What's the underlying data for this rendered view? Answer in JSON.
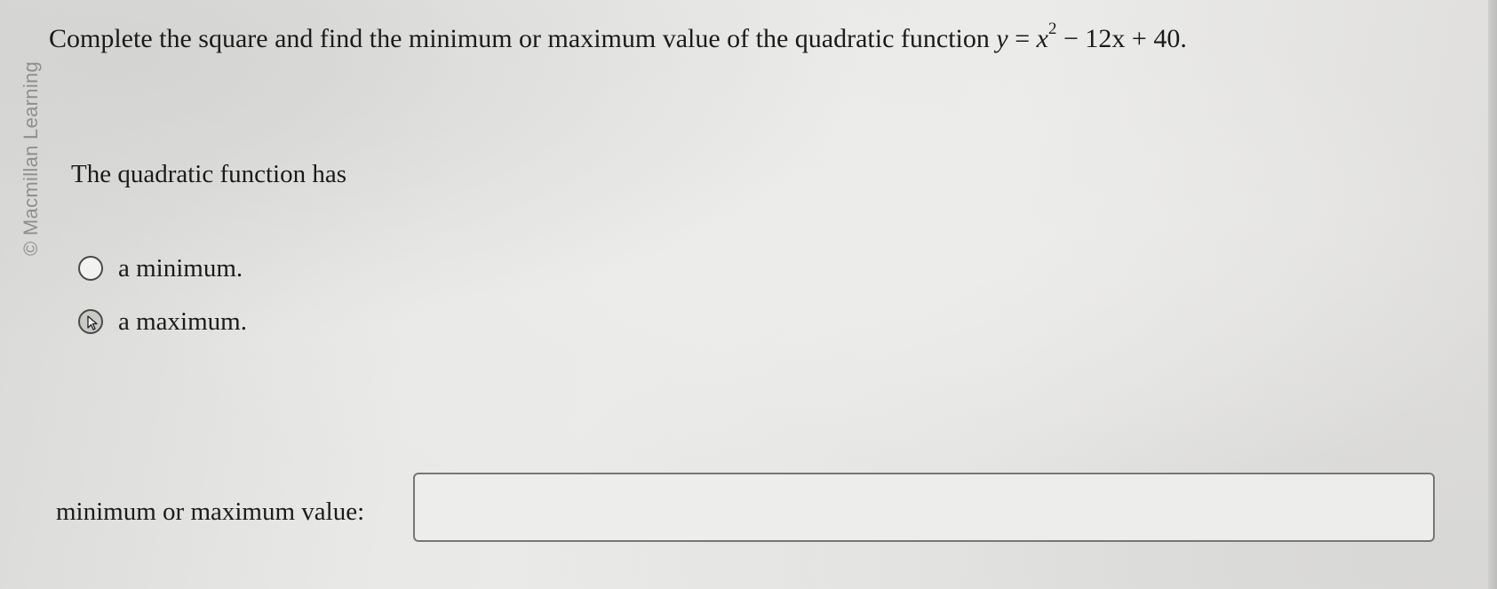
{
  "watermark": "© Macmillan Learning",
  "question": {
    "text": "Complete the square and find the minimum or maximum value of the quadratic function",
    "equation_y": "y",
    "equation_eq": " = ",
    "equation_x": "x",
    "equation_exp": "2",
    "equation_rest": " − 12x + 40."
  },
  "prompt": "The quadratic function has",
  "options": [
    {
      "label": "a minimum."
    },
    {
      "label": "a maximum."
    }
  ],
  "answer": {
    "label": "minimum or maximum value:",
    "value": ""
  },
  "colors": {
    "background": "#e6e6e4",
    "text": "#1b1b1b",
    "watermark": "#8f8f8f"
  },
  "icons": {
    "option_hover_cursor": "pointer-cursor-icon"
  }
}
